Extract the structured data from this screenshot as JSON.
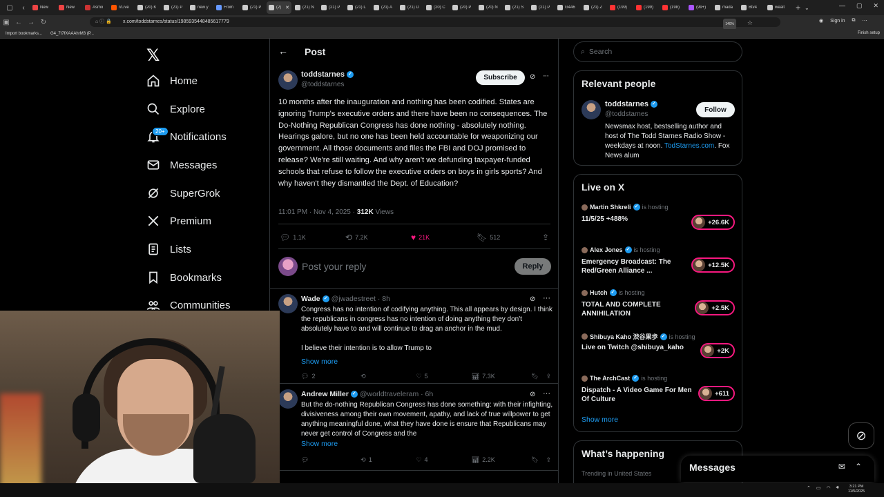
{
  "browser": {
    "tabs": [
      {
        "label": "New",
        "color": "#e44"
      },
      {
        "label": "New",
        "color": "#e44"
      },
      {
        "label": "Asmo",
        "color": "#c33"
      },
      {
        "label": "r/Live",
        "color": "#f50"
      },
      {
        "label": "(20) K",
        "color": "#ccc"
      },
      {
        "label": "(21) P",
        "color": "#ccc"
      },
      {
        "label": "new y",
        "color": "#ccc"
      },
      {
        "label": "From",
        "color": "#69f"
      },
      {
        "label": "(21) P",
        "color": "#ccc"
      },
      {
        "label": "(2) ",
        "color": "#ccc",
        "active": true
      },
      {
        "label": "(21) N",
        "color": "#ccc"
      },
      {
        "label": "(21) P",
        "color": "#ccc"
      },
      {
        "label": "(21) L",
        "color": "#ccc"
      },
      {
        "label": "(21) A",
        "color": "#ccc"
      },
      {
        "label": "(21) D",
        "color": "#ccc"
      },
      {
        "label": "(20) C",
        "color": "#ccc"
      },
      {
        "label": "(20) P",
        "color": "#ccc"
      },
      {
        "label": "(20) N",
        "color": "#ccc"
      },
      {
        "label": "(21) S",
        "color": "#ccc"
      },
      {
        "label": "(21) P",
        "color": "#ccc"
      },
      {
        "label": "G446",
        "color": "#ccc"
      },
      {
        "label": "(21) Z",
        "color": "#ccc"
      },
      {
        "label": "(199)",
        "color": "#f33"
      },
      {
        "label": "(199)",
        "color": "#f33"
      },
      {
        "label": "(198)",
        "color": "#f33"
      },
      {
        "label": "(99+)",
        "color": "#a5f"
      },
      {
        "label": "mada",
        "color": "#ccc"
      },
      {
        "label": "Btv4",
        "color": "#ccc"
      },
      {
        "label": "wealt",
        "color": "#ccc"
      }
    ],
    "url": "x.com/toddstarnes/status/1985935448485617779",
    "zoom": "140%",
    "signin": "Sign in",
    "bookmarks": [
      "Import bookmarks...",
      "G4_7t7fXAAAhrM3 (P..."
    ],
    "finish_setup": "Finish setup"
  },
  "nav": {
    "items": [
      {
        "label": "Home",
        "icon": "home-icon"
      },
      {
        "label": "Explore",
        "icon": "search-icon"
      },
      {
        "label": "Notifications",
        "icon": "bell-icon",
        "badge": "20+"
      },
      {
        "label": "Messages",
        "icon": "mail-icon"
      },
      {
        "label": "SuperGrok",
        "icon": "grok-icon"
      },
      {
        "label": "Premium",
        "icon": "x-logo-icon"
      },
      {
        "label": "Lists",
        "icon": "list-icon"
      },
      {
        "label": "Bookmarks",
        "icon": "bookmark-icon"
      },
      {
        "label": "Communities",
        "icon": "people-icon"
      }
    ]
  },
  "main": {
    "title": "Post",
    "post": {
      "name": "toddstarnes",
      "handle": "@toddstarnes",
      "subscribe": "Subscribe",
      "body": "10 months after the inauguration and nothing has been codified. States are ignoring Trump's executive orders and there have been no consequences. The Do-Nothing Republican Congress has done nothing - absolutely nothing. Hearings galore, but no one has been held accountable for weaponizing our government. All those documents and files the FBI and DOJ promised to release? We're still waiting. And why aren't we defunding taxpayer-funded schools that refuse to follow the executive orders on boys in girls sports? And why haven't they dismantled the Dept. of Education?",
      "time": "11:01 PM · Nov 4, 2025 · ",
      "views_count": "312K",
      "views_label": " Views",
      "replies": "1.1K",
      "reposts": "7.2K",
      "likes": "21K",
      "bookmarks": "512"
    },
    "reply_box": {
      "placeholder": "Post your reply",
      "button": "Reply"
    },
    "replies": [
      {
        "name": "Wade",
        "handle": "@jwadestreet · 8h",
        "text": "Congress has no intention of codifying anything. This all appears by design. I think the republicans in congress has no intention of doing anything they don't absolutely  have to and will continue to drag an anchor in the mud.",
        "text2": "I believe their intention is to allow Trump to",
        "show_more": "Show more",
        "replies": "2",
        "reposts": "",
        "likes": "5",
        "views": "7.3K"
      },
      {
        "name": "Andrew Miller",
        "handle": "@worldtraveleram · 6h",
        "text": "But the do-nothing Republican Congress has done something: with their infighting, divisiveness among their own movement, apathy, and lack of true willpower to get anything meaningful done, what they have done is ensure that Republicans may never get control of Congress and the",
        "text2": "",
        "show_more": "Show more",
        "replies": "",
        "reposts": "1",
        "likes": "4",
        "views": "2.2K"
      }
    ]
  },
  "right": {
    "search_placeholder": "Search",
    "relevant": {
      "title": "Relevant people",
      "name": "toddstarnes",
      "handle": "@toddstarnes",
      "follow": "Follow",
      "bio": "Newsmax host, bestselling author and host of The Todd Starnes Radio Show - weekdays at noon. ",
      "bio_link": "TodStarnes.com",
      "bio_end": ". Fox News alum"
    },
    "live": {
      "title": "Live on X",
      "items": [
        {
          "host": "Martin Shkreli",
          "is": "is hosting",
          "title": "11/5/25 +488%",
          "count": "+26.6K"
        },
        {
          "host": "Alex Jones",
          "is": "is hosting",
          "title": "Emergency Broadcast: The Red/Green Alliance ...",
          "count": "+12.5K"
        },
        {
          "host": "Hutch",
          "is": "is hosting",
          "title": "TOTAL AND COMPLETE ANNIHILATION",
          "count": "+2.5K"
        },
        {
          "host": "Shibuya Kaho 渋谷果歩",
          "is": "is hosting",
          "title": "Live on Twitch @shibuya_kaho",
          "count": "+2K"
        },
        {
          "host": "The ArchCast",
          "is": "is hosting",
          "title": "Dispatch - A Video Game For Men Of Culture",
          "count": "+611"
        }
      ],
      "show_more": "Show more"
    },
    "happening": {
      "title": "What’s happening",
      "trending": "Trending in United States"
    },
    "messages_title": "Messages"
  },
  "taskbar": {
    "time": "3:21 PM",
    "date": "11/5/2025"
  }
}
